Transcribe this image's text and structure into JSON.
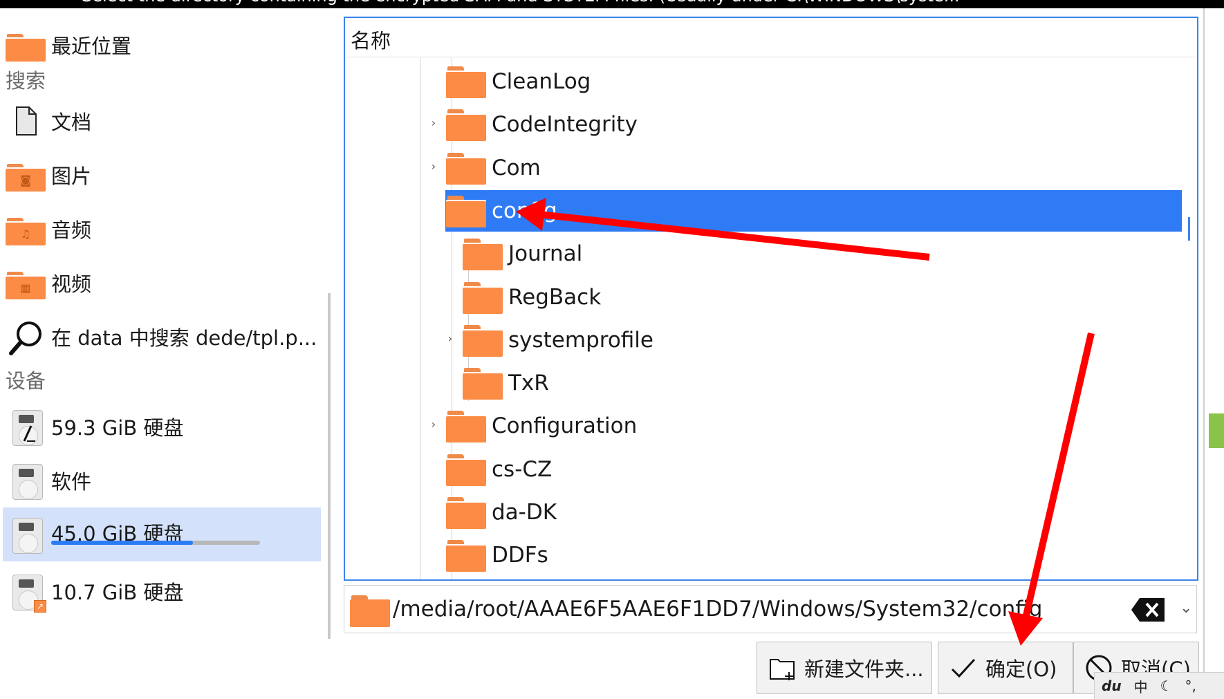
{
  "window": {
    "title": "Select the directory containing the encrypted SAM and SYSTEM files. (Usually under C:\\WINDOWS\\syste..."
  },
  "sidebar": {
    "recent": "最近位置",
    "search_section": "搜索",
    "places": [
      {
        "label": "文档",
        "icon": "document-icon"
      },
      {
        "label": "图片",
        "icon": "pictures-folder-icon"
      },
      {
        "label": "音频",
        "icon": "music-folder-icon"
      },
      {
        "label": "视频",
        "icon": "video-folder-icon"
      }
    ],
    "saved_search": "在 data 中搜索 dede/tpl.p...",
    "devices_section": "设备",
    "devices": [
      {
        "label": "59.3 GiB 硬盘"
      },
      {
        "label": "软件"
      },
      {
        "label": "45.0 GiB 硬盘",
        "selected": true,
        "usage_fraction": 0.68
      },
      {
        "label": "10.7 GiB 硬盘"
      }
    ]
  },
  "tree": {
    "header": "名称",
    "rows": [
      {
        "name": "CleanLog",
        "level": 1,
        "expander": ""
      },
      {
        "name": "CodeIntegrity",
        "level": 1,
        "expander": "›"
      },
      {
        "name": "Com",
        "level": 1,
        "expander": "›"
      },
      {
        "name": "config",
        "level": 1,
        "expander": "⌄",
        "selected": true
      },
      {
        "name": "Journal",
        "level": 2,
        "expander": ""
      },
      {
        "name": "RegBack",
        "level": 2,
        "expander": ""
      },
      {
        "name": "systemprofile",
        "level": 2,
        "expander": "›"
      },
      {
        "name": "TxR",
        "level": 2,
        "expander": ""
      },
      {
        "name": "Configuration",
        "level": 1,
        "expander": "›"
      },
      {
        "name": "cs-CZ",
        "level": 1,
        "expander": ""
      },
      {
        "name": "da-DK",
        "level": 1,
        "expander": ""
      },
      {
        "name": "DDFs",
        "level": 1,
        "expander": ""
      }
    ]
  },
  "pathbar": {
    "value": "/media/root/AAAE6F5AAE6F1DD7/Windows/System32/config"
  },
  "buttons": {
    "new_folder": "新建文件夹...",
    "ok": "确定(O)",
    "cancel": "取消(C)"
  },
  "ime": {
    "logo": "du",
    "lang": "中"
  },
  "colors": {
    "accent": "#2f7bf5",
    "folder": "#fb8b45",
    "annotation_arrow": "#ff0000"
  }
}
